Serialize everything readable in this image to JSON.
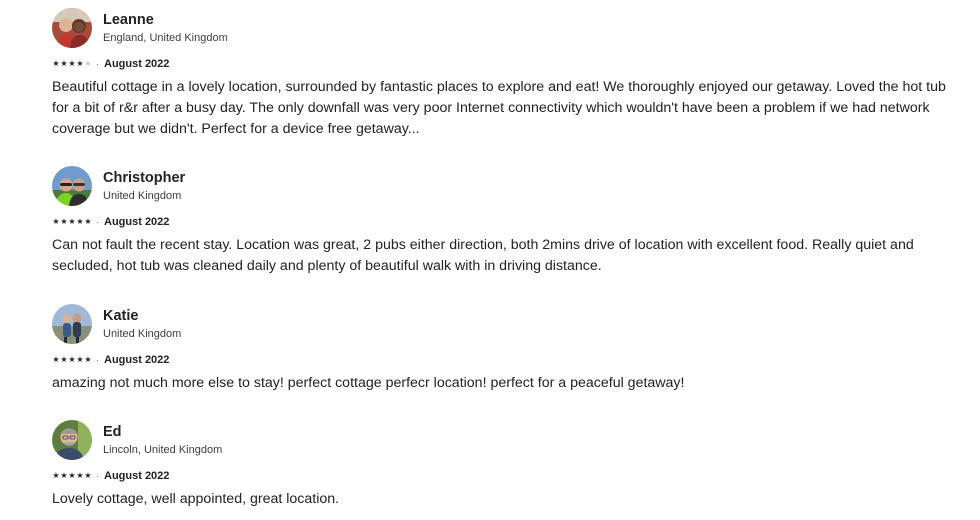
{
  "reviews": [
    {
      "name": "Leanne",
      "location": "England, United Kingdom",
      "rating": 4,
      "date": "August 2022",
      "text": "Beautiful cottage in a lovely location, surrounded by  fantastic places to explore and eat! We thoroughly enjoyed our getaway. Loved the hot tub for a bit of r&r after a busy day. The only downfall was very poor Internet connectivity which wouldn't have been a problem if we had network coverage but we didn't. Perfect for a device free getaway...",
      "separator": "·",
      "avatar_icon": "user-photo-icon"
    },
    {
      "name": "Christopher",
      "location": "United Kingdom",
      "rating": 5,
      "date": "August 2022",
      "text": "Can not fault the recent stay. Location was great, 2 pubs either direction, both 2mins drive of location with excellent food. Really quiet and secluded, hot tub was cleaned daily and plenty of beautiful walk with in driving distance.",
      "separator": "·",
      "avatar_icon": "user-photo-icon"
    },
    {
      "name": "Katie",
      "location": "United Kingdom",
      "rating": 5,
      "date": "August 2022",
      "text": "amazing not much more else to stay! perfect cottage perfecr location! perfect for a peaceful getaway!",
      "separator": "·",
      "avatar_icon": "user-photo-icon"
    },
    {
      "name": "Ed",
      "location": "Lincoln, United Kingdom",
      "rating": 5,
      "date": "August 2022",
      "text": "Lovely cottage, well appointed, great location.",
      "separator": "·",
      "avatar_icon": "user-photo-icon"
    }
  ],
  "star_glyph": "★",
  "colors": {
    "text": "#222222",
    "secondary": "#3d3d3d",
    "star_on": "#222222",
    "star_off": "#c9c9c9"
  }
}
